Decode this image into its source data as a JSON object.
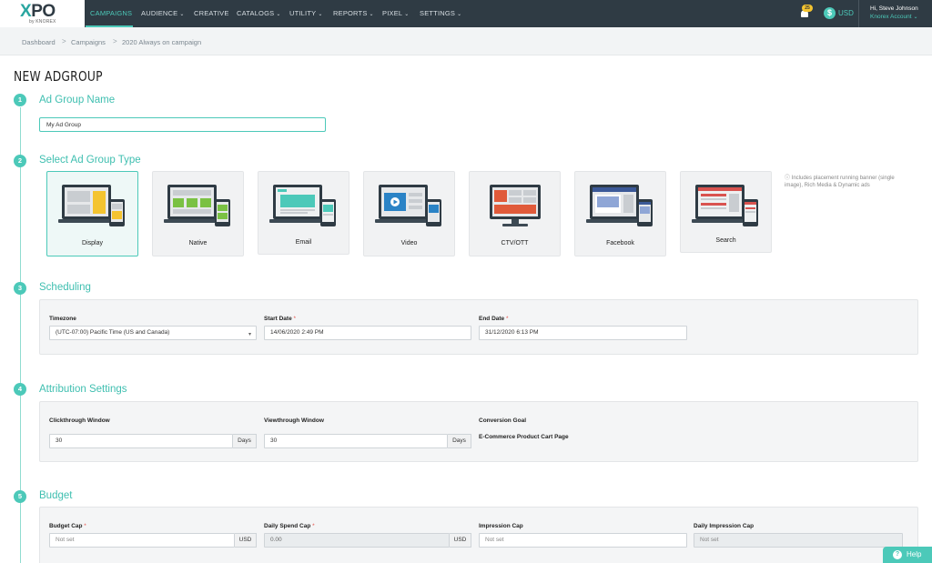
{
  "logo": {
    "main": "XPO",
    "sub": "by KNOREX"
  },
  "nav": {
    "items": [
      {
        "label": "CAMPAIGNS",
        "caret": false
      },
      {
        "label": "AUDIENCE",
        "caret": true
      },
      {
        "label": "CREATIVE",
        "caret": false
      },
      {
        "label": "CATALOGS",
        "caret": true
      },
      {
        "label": "UTILITY",
        "caret": true
      },
      {
        "label": "REPORTS",
        "caret": true
      },
      {
        "label": "PIXEL",
        "caret": true
      },
      {
        "label": "SETTINGS",
        "caret": true
      }
    ],
    "notifications_count": "25",
    "currency_symbol": "$",
    "currency": "USD",
    "user_greeting": "Hi, Steve Johnson",
    "account": "Knorex Account"
  },
  "breadcrumb": {
    "items": [
      "Dashboard",
      "Campaigns",
      "2020 Always on campaign"
    ],
    "separator": ">"
  },
  "page_title": "NEW ADGROUP",
  "steps": {
    "s1": {
      "num": "1",
      "title": "Ad Group Name"
    },
    "s2": {
      "num": "2",
      "title": "Select Ad Group Type"
    },
    "s3": {
      "num": "3",
      "title": "Scheduling"
    },
    "s4": {
      "num": "4",
      "title": "Attribution Settings"
    },
    "s5": {
      "num": "5",
      "title": "Budget"
    }
  },
  "adgroup_name": {
    "value": "My Ad Group"
  },
  "adgroup_types": {
    "items": [
      "Display",
      "Native",
      "Email",
      "Video",
      "CTV/OTT",
      "Facebook",
      "Search"
    ],
    "selected": "Display",
    "note": "Includes placement running banner (single image), Rich Media & Dynamic ads"
  },
  "scheduling": {
    "timezone_label": "Timezone",
    "timezone_value": "(UTC-07:00) Pacific Time (US and Canada)",
    "start_label": "Start Date",
    "start_value": "14/06/2020 2:49 PM",
    "end_label": "End Date",
    "end_value": "31/12/2020 6:13 PM",
    "required_mark": "*"
  },
  "attribution": {
    "click_label": "Clickthrough Window",
    "click_value": "30",
    "view_label": "Viewthrough Window",
    "view_value": "30",
    "days_unit": "Days",
    "goal_label": "Conversion Goal",
    "goal_value": "E-Commerce Product Cart Page"
  },
  "budget": {
    "budget_cap_label": "Budget Cap",
    "budget_cap_placeholder": "Not set",
    "daily_spend_label": "Daily Spend Cap",
    "daily_spend_value": "0.00",
    "impression_label": "Impression Cap",
    "impression_placeholder": "Not set",
    "daily_impression_label": "Daily Impression Cap",
    "daily_impression_placeholder": "Not set",
    "currency_unit": "USD",
    "required_mark": "*"
  },
  "help": {
    "label": "Help",
    "icon": "question-icon"
  },
  "colors": {
    "accent": "#4cc9b9",
    "nav_bg": "#2f3b44",
    "required": "#e5534b"
  }
}
